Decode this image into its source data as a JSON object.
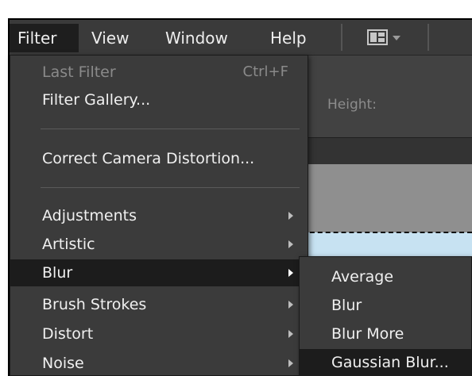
{
  "menubar": {
    "items": [
      "Filter",
      "View",
      "Window",
      "Help"
    ],
    "layout_icon": "layout-grid-icon"
  },
  "options_bar": {
    "height_label": "Height:"
  },
  "filter_menu": {
    "last_filter": {
      "label": "Last Filter",
      "shortcut": "Ctrl+F",
      "enabled": false
    },
    "filter_gallery": "Filter Gallery...",
    "correct_camera_distortion": "Correct Camera Distortion...",
    "submenus": [
      "Adjustments",
      "Artistic",
      "Blur",
      "Brush Strokes",
      "Distort",
      "Noise"
    ],
    "highlighted": "Blur"
  },
  "blur_submenu": {
    "items": [
      "Average",
      "Blur",
      "Blur More",
      "Gaussian Blur..."
    ],
    "highlighted": "Gaussian Blur..."
  },
  "colors": {
    "menu_bg": "#3b3b3b",
    "highlight_bg": "#1c1c1c",
    "canvas_image": "#c7e2f2"
  }
}
